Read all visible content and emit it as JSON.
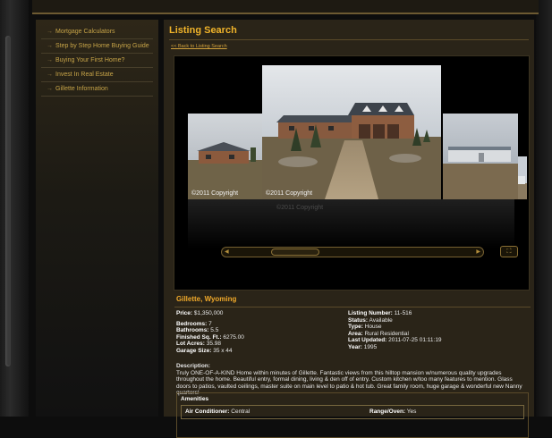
{
  "sidebar": {
    "items": [
      {
        "label": "Mortgage Calculators"
      },
      {
        "label": "Step by Step Home Buying Guide"
      },
      {
        "label": "Buying Your First Home?"
      },
      {
        "label": "Invest In Real Estate"
      },
      {
        "label": "Gillette Information"
      }
    ],
    "arrow": "→"
  },
  "main": {
    "title": "Listing Search",
    "back_link": "<< Back to Listing Search"
  },
  "gallery": {
    "main_caption": "©2011 Copyright",
    "left_caption": "©2011 Copyright",
    "reflection_caption": "©2011 Copyright",
    "left_arrow": "◀",
    "right_arrow": "▶",
    "fullscreen_symbol": "⛶"
  },
  "listing": {
    "location": "Gillette, Wyoming",
    "price_label": "Price:",
    "price": "$1,350,000",
    "bedrooms_label": "Bedrooms:",
    "bedrooms": "7",
    "bathrooms_label": "Bathrooms:",
    "bathrooms": "5.5",
    "sqft_label": "Finished Sq. Ft.:",
    "sqft": "6275.00",
    "acres_label": "Lot Acres:",
    "acres": "35.98",
    "garage_label": "Garage Size:",
    "garage": "35 x 44",
    "listing_number_label": "Listing Number:",
    "listing_number": "11-516",
    "status_label": "Status:",
    "status": "Available",
    "type_label": "Type:",
    "type": "House",
    "area_label": "Area:",
    "area": "Rural Residential",
    "updated_label": "Last Updated:",
    "updated": "2011-07-25 01:11:19",
    "year_label": "Year:",
    "year": "1995",
    "description_label": "Description:",
    "description": "Truly ONE-OF-A-KIND Home within minutes of Gillette. Fantastic views from this hilltop mansion w/numerous quality upgrades throughout the home. Beautiful entry, formal dining, living & den off of entry. Custom kitchen w/too many features to mention. Glass doors to patios, vaulted ceilings, master suite on main level to patio & hot tub. Great family room, huge garage & wonderful new Nanny quarters!"
  },
  "amenities": {
    "title": "Amenities",
    "left_label": "Air Conditioner:",
    "left_value": "Central",
    "right_label": "Range/Oven:",
    "right_value": "Yes"
  }
}
